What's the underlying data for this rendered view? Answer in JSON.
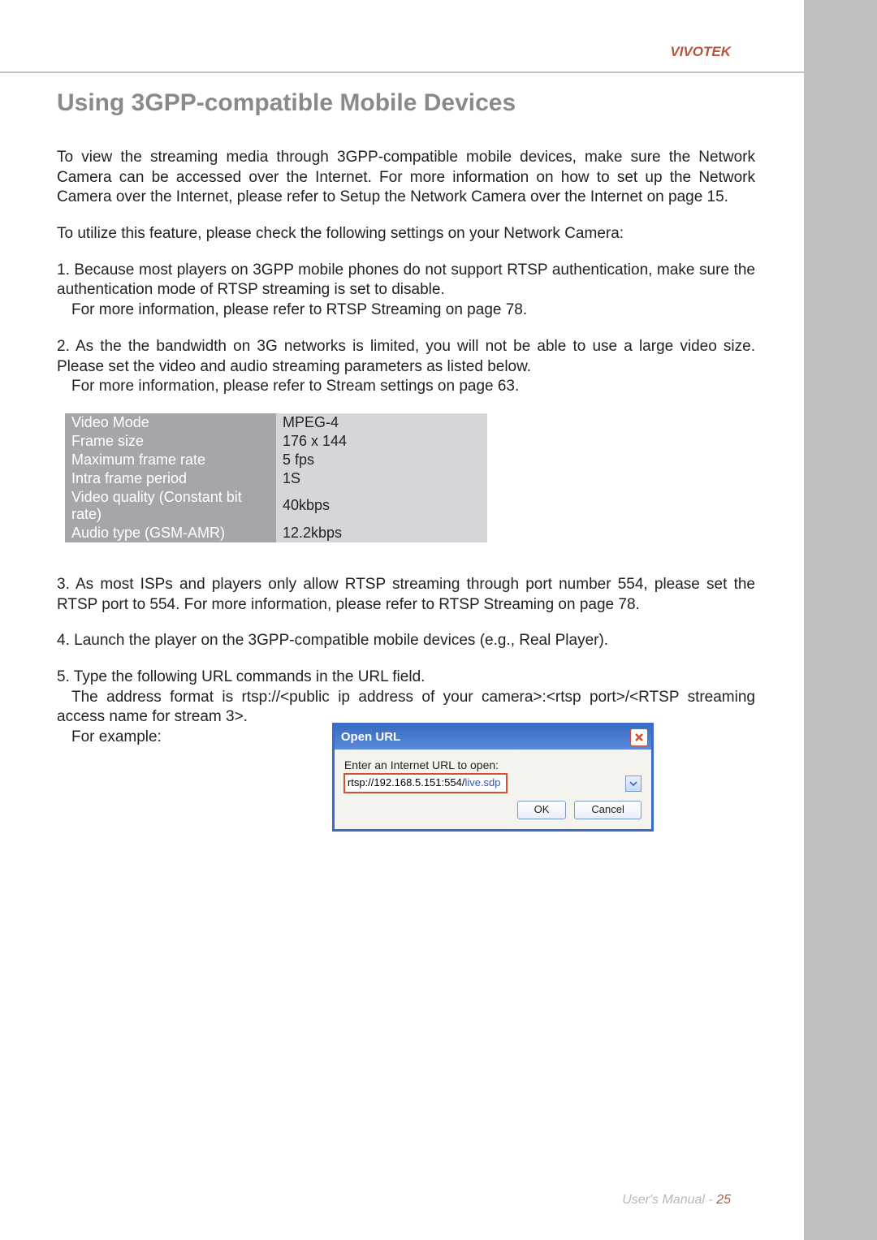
{
  "brand": "VIVOTEK",
  "heading": "Using 3GPP-compatible Mobile Devices",
  "para1": "To view the streaming media through 3GPP-compatible mobile devices, make sure the Network Camera can be accessed over the Internet. For more information on how to set up the Network Camera over the Internet, please refer to Setup the Network Camera over the Internet on page 15.",
  "para2": "To utilize this feature, please check the following settings on your Network Camera:",
  "item1_a": "1. Because most players on 3GPP mobile phones do not support RTSP authentication, make sure the authentication mode of RTSP streaming is set to disable.",
  "item1_b": "For more information, please refer to RTSP Streaming on page 78.",
  "item2_a": "2. As the the bandwidth on 3G networks is limited, you will not be able to use a large video size. Please set the video and audio streaming parameters as listed below.",
  "item2_b": "For more information, please refer to Stream settings on page 63.",
  "table": {
    "rows": [
      {
        "label": "Video Mode",
        "value": "MPEG-4"
      },
      {
        "label": "Frame size",
        "value": "176 x 144"
      },
      {
        "label": "Maximum frame rate",
        "value": "5 fps"
      },
      {
        "label": "Intra frame period",
        "value": "1S"
      },
      {
        "label": "Video quality (Constant bit rate)",
        "value": "40kbps"
      },
      {
        "label": "Audio type (GSM-AMR)",
        "value": "12.2kbps"
      }
    ]
  },
  "item3": "3. As most ISPs and players only allow RTSP streaming through port number 554, please set the RTSP port to 554. For more information, please refer to RTSP Streaming on page 78.",
  "item4": "4. Launch the player on the 3GPP-compatible mobile devices (e.g., Real Player).",
  "item5_a": "5. Type the following URL commands in the URL field.",
  "item5_b": "The address format is rtsp://<public ip address of your camera>:<rtsp port>/<RTSP streaming access name for stream 3>.",
  "item5_c": "For example:",
  "dialog": {
    "title": "Open URL",
    "label": "Enter an Internet URL to open:",
    "url_prefix": "rtsp://192.168.5.151:554/",
    "url_highlight": "live.sdp",
    "ok": "OK",
    "cancel": "Cancel"
  },
  "footer": {
    "text": "User's Manual - ",
    "page": "25"
  }
}
